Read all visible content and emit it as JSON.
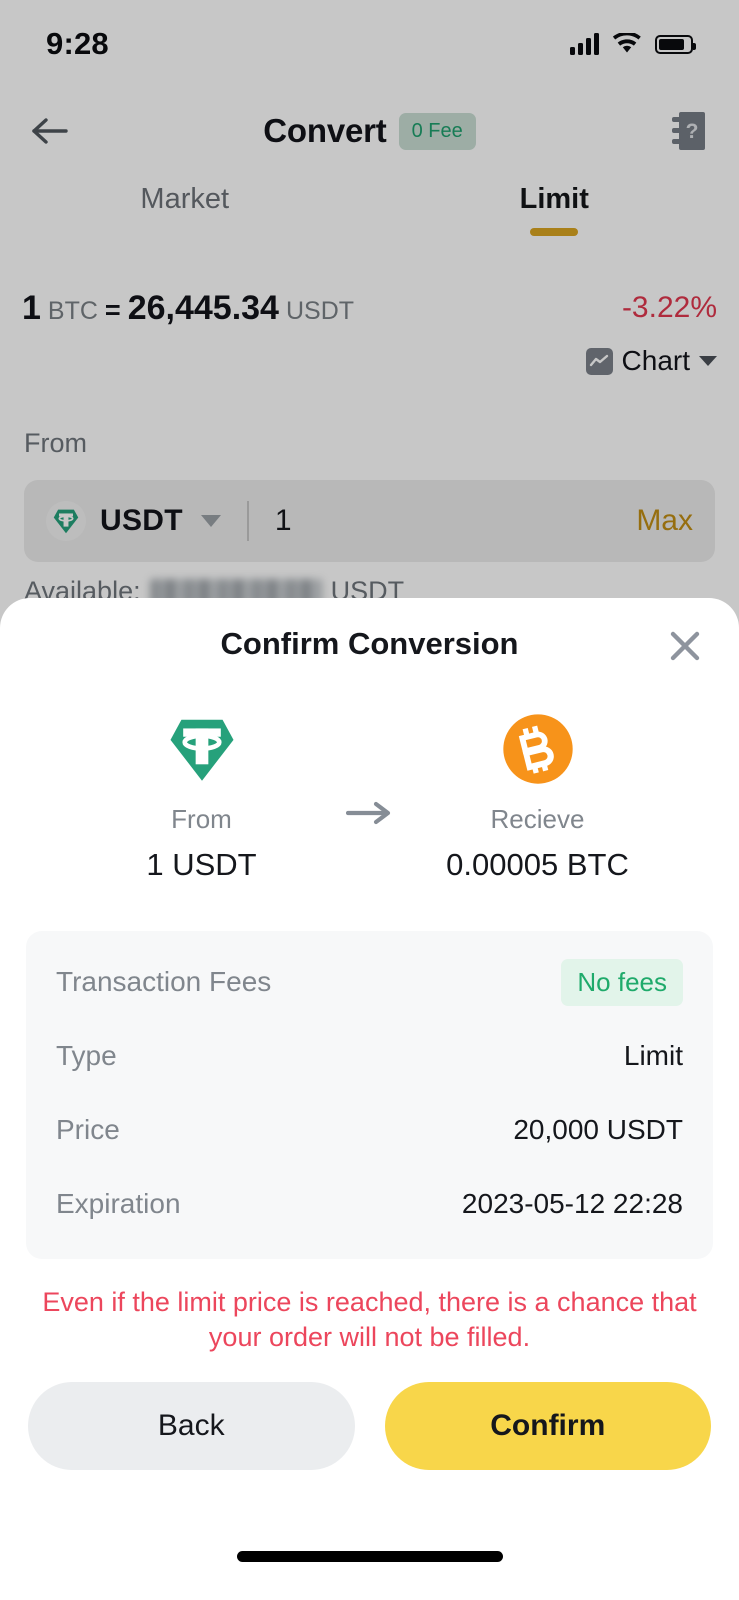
{
  "status_bar": {
    "time": "9:28",
    "signal_icon": "cellular-signal-icon",
    "wifi_icon": "wifi-icon",
    "battery_icon": "battery-icon"
  },
  "header": {
    "back_icon": "back-arrow-icon",
    "title": "Convert",
    "fee_badge": "0 Fee",
    "help_icon": "help-manual-icon"
  },
  "tabs": [
    {
      "label": "Market",
      "active": false
    },
    {
      "label": "Limit",
      "active": true
    }
  ],
  "rate": {
    "base_amount": "1",
    "base_symbol": "BTC",
    "equals": "=",
    "quote_amount": "26,445.34",
    "quote_symbol": "USDT",
    "change": "-3.22%",
    "change_color": "#e0384f"
  },
  "chart_toggle": {
    "icon": "line-chart-icon",
    "label": "Chart",
    "chevron": "chevron-down-icon"
  },
  "from_section": {
    "label": "From",
    "coin_icon": "tether-icon",
    "coin_symbol": "USDT",
    "dropdown_icon": "triangle-down-icon",
    "amount": "1",
    "max_label": "Max",
    "available_prefix": "Available:",
    "available_value_hidden": true,
    "available_symbol": "USDT"
  },
  "modal": {
    "title": "Confirm Conversion",
    "close_icon": "close-icon",
    "from": {
      "logo": "tether-logo-icon",
      "caption": "From",
      "value": "1 USDT"
    },
    "arrow_icon": "arrow-right-icon",
    "receive": {
      "logo": "bitcoin-logo-icon",
      "caption": "Recieve",
      "value": "0.00005 BTC"
    },
    "details": [
      {
        "key": "Transaction Fees",
        "value": "No fees",
        "badge": true
      },
      {
        "key": "Type",
        "value": "Limit",
        "badge": false
      },
      {
        "key": "Price",
        "value": "20,000 USDT",
        "badge": false
      },
      {
        "key": "Expiration",
        "value": "2023-05-12 22:28",
        "badge": false
      }
    ],
    "warning": "Even if the limit price is reached, there is a chance that your order will not be filled.",
    "back_button": "Back",
    "confirm_button": "Confirm"
  },
  "colors": {
    "accent_yellow": "#f8d64a",
    "tab_underline": "#d9a420",
    "tether_green": "#26a17b",
    "bitcoin_orange": "#f7931a",
    "warning_red": "#ec465c",
    "badge_green": "#1faa6b"
  },
  "home_indicator": "home-indicator"
}
